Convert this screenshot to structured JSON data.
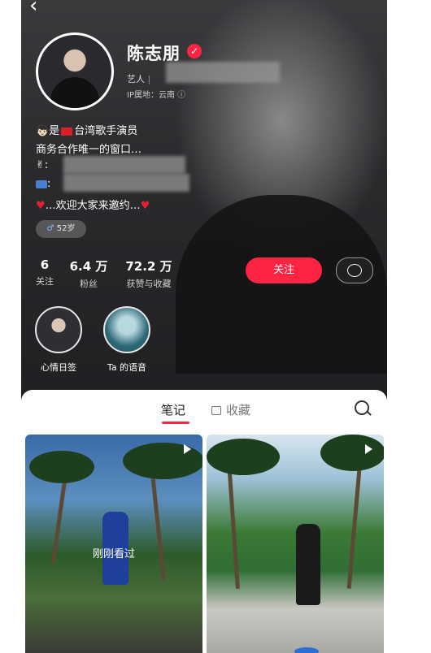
{
  "profile": {
    "name": "陈志朋",
    "role": "艺人",
    "ip_location": "IP属地：云南",
    "bio": {
      "line1": "是",
      "line1_rest": "台湾歌手演员",
      "line2": "商务合作唯一的窗口…",
      "line3": "✌:",
      "line4": ":",
      "line5": "…欢迎大家来邀约…"
    },
    "age_tag": "52岁"
  },
  "stats": [
    {
      "num": "6",
      "label": "关注"
    },
    {
      "num": "6.4 万",
      "label": "粉丝"
    },
    {
      "num": "72.2 万",
      "label": "获赞与收藏"
    }
  ],
  "actions": {
    "follow": "关注"
  },
  "stories": [
    {
      "label": "心情日签"
    },
    {
      "label": "Ta 的语音"
    }
  ],
  "tabs": {
    "notes": "笔记",
    "favorites": "收藏"
  },
  "notes": [
    {
      "overlay": "刚刚看过"
    },
    {
      "overlay": ""
    }
  ],
  "colors": {
    "accent": "#ff2442"
  }
}
